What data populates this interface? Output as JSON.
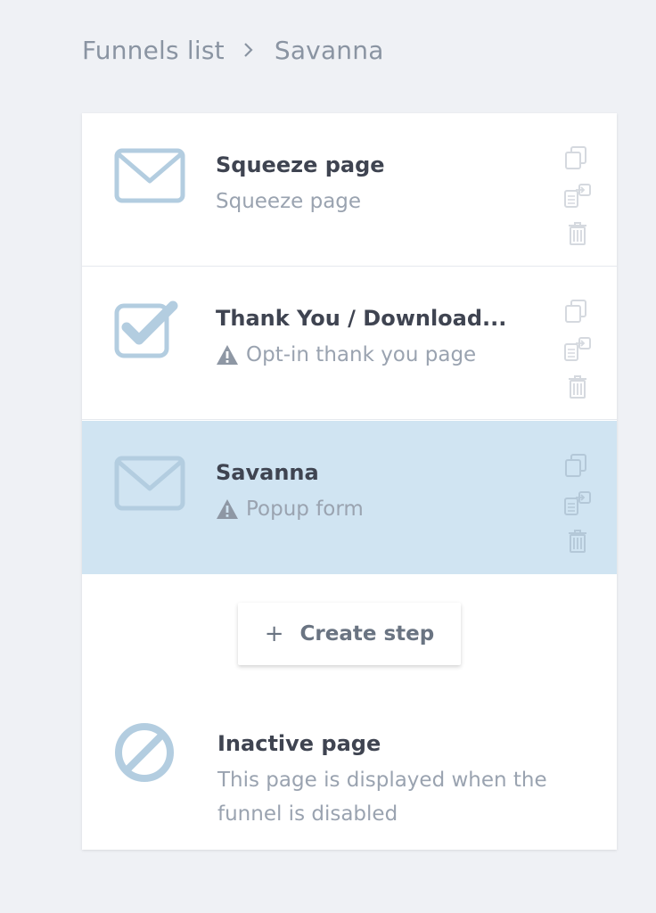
{
  "breadcrumb": {
    "root": "Funnels list",
    "current": "Savanna"
  },
  "steps": [
    {
      "title": "Squeeze page",
      "subtitle": "Squeeze page",
      "icon": "envelope-icon",
      "warning": false,
      "selected": false
    },
    {
      "title": "Thank You / Download...",
      "subtitle": "Opt-in thank you page",
      "icon": "checkbox-icon",
      "warning": true,
      "selected": false
    },
    {
      "title": "Savanna",
      "subtitle": "Popup form",
      "icon": "envelope-icon",
      "warning": true,
      "selected": true
    }
  ],
  "step_actions": [
    "duplicate-icon",
    "copy-to-funnel-icon",
    "trash-icon"
  ],
  "create_step": {
    "plus": "+",
    "label": "Create step"
  },
  "inactive": {
    "title": "Inactive page",
    "description": "This page is displayed when the funnel is disabled",
    "icon": "disabled-icon"
  },
  "colors": {
    "icon_blue": "#b3cde0",
    "selected_bg": "#d0e4f2",
    "title": "#3f4451",
    "muted": "#9aa3b0"
  }
}
